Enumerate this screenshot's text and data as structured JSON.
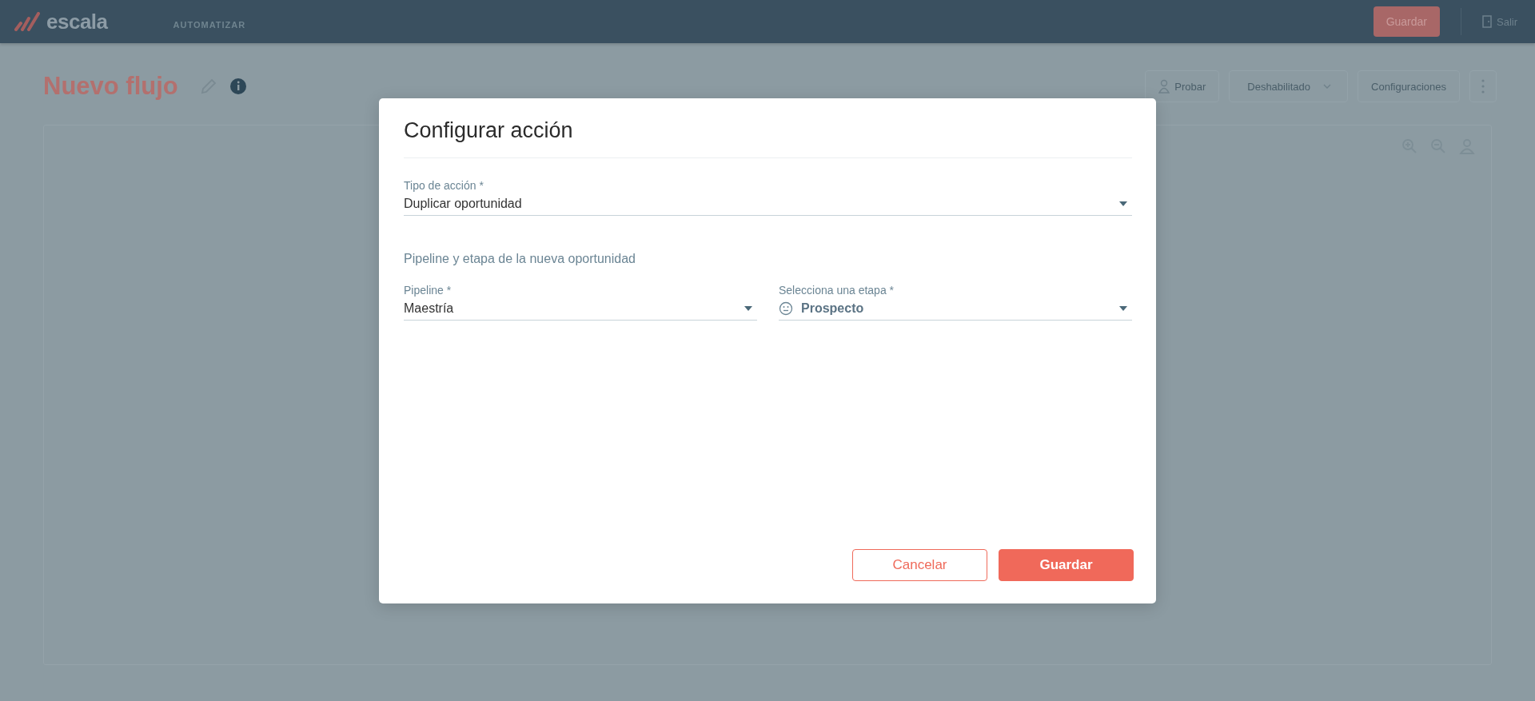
{
  "header": {
    "logo": "escala",
    "nav_item": "AUTOMATIZAR",
    "save_button": "Guardar",
    "exit_link": "Salir"
  },
  "page": {
    "title": "Nuevo flujo",
    "toolbar": [
      {
        "kind": "test",
        "label": "Probar"
      },
      {
        "kind": "dropdown",
        "label": "Deshabilitado"
      },
      {
        "kind": "plain",
        "label": "Configuraciones"
      },
      {
        "kind": "more"
      }
    ]
  },
  "modal": {
    "title": "Configurar acción",
    "action_type": {
      "label": "Tipo de acción *",
      "value": "Duplicar oportunidad"
    },
    "section_heading": "Pipeline y etapa de la nueva oportunidad",
    "fields": [
      {
        "kind": "select",
        "label": "Pipeline *",
        "value": "Maestría"
      },
      {
        "kind": "stage",
        "label": "Selecciona una etapa *",
        "value": "Prospecto"
      }
    ],
    "buttons": [
      {
        "kind": "secondary",
        "label": "Cancelar"
      },
      {
        "kind": "primary",
        "label": "Guardar"
      }
    ]
  }
}
